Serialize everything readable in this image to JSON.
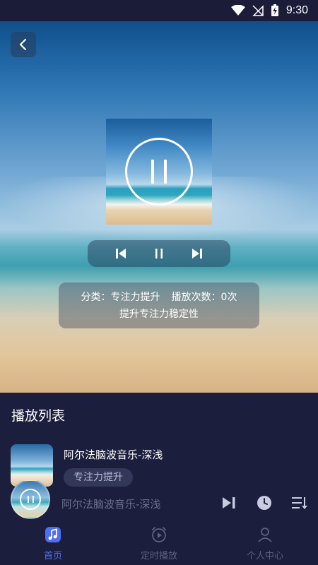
{
  "status_bar": {
    "time": "9:30"
  },
  "player": {
    "info_line1_part1": "分类：专注力提升",
    "info_line1_part2": "播放次数：0次",
    "info_line2": "提升专注力稳定性"
  },
  "playlist": {
    "title": "播放列表",
    "items": [
      {
        "name": "阿尔法脑波音乐-深浅",
        "tag": "专注力提升"
      }
    ]
  },
  "mini_player": {
    "track_name": "阿尔法脑波音乐-深浅"
  },
  "nav": {
    "items": [
      {
        "label": "首页",
        "icon": "music-note-icon",
        "active": true
      },
      {
        "label": "定时播放",
        "icon": "alarm-clock-icon",
        "active": false
      },
      {
        "label": "个人中心",
        "icon": "person-icon",
        "active": false
      }
    ]
  },
  "colors": {
    "accent": "#4f6ff2",
    "background": "#1b1e3c",
    "muted_text": "#6b6f8d"
  }
}
